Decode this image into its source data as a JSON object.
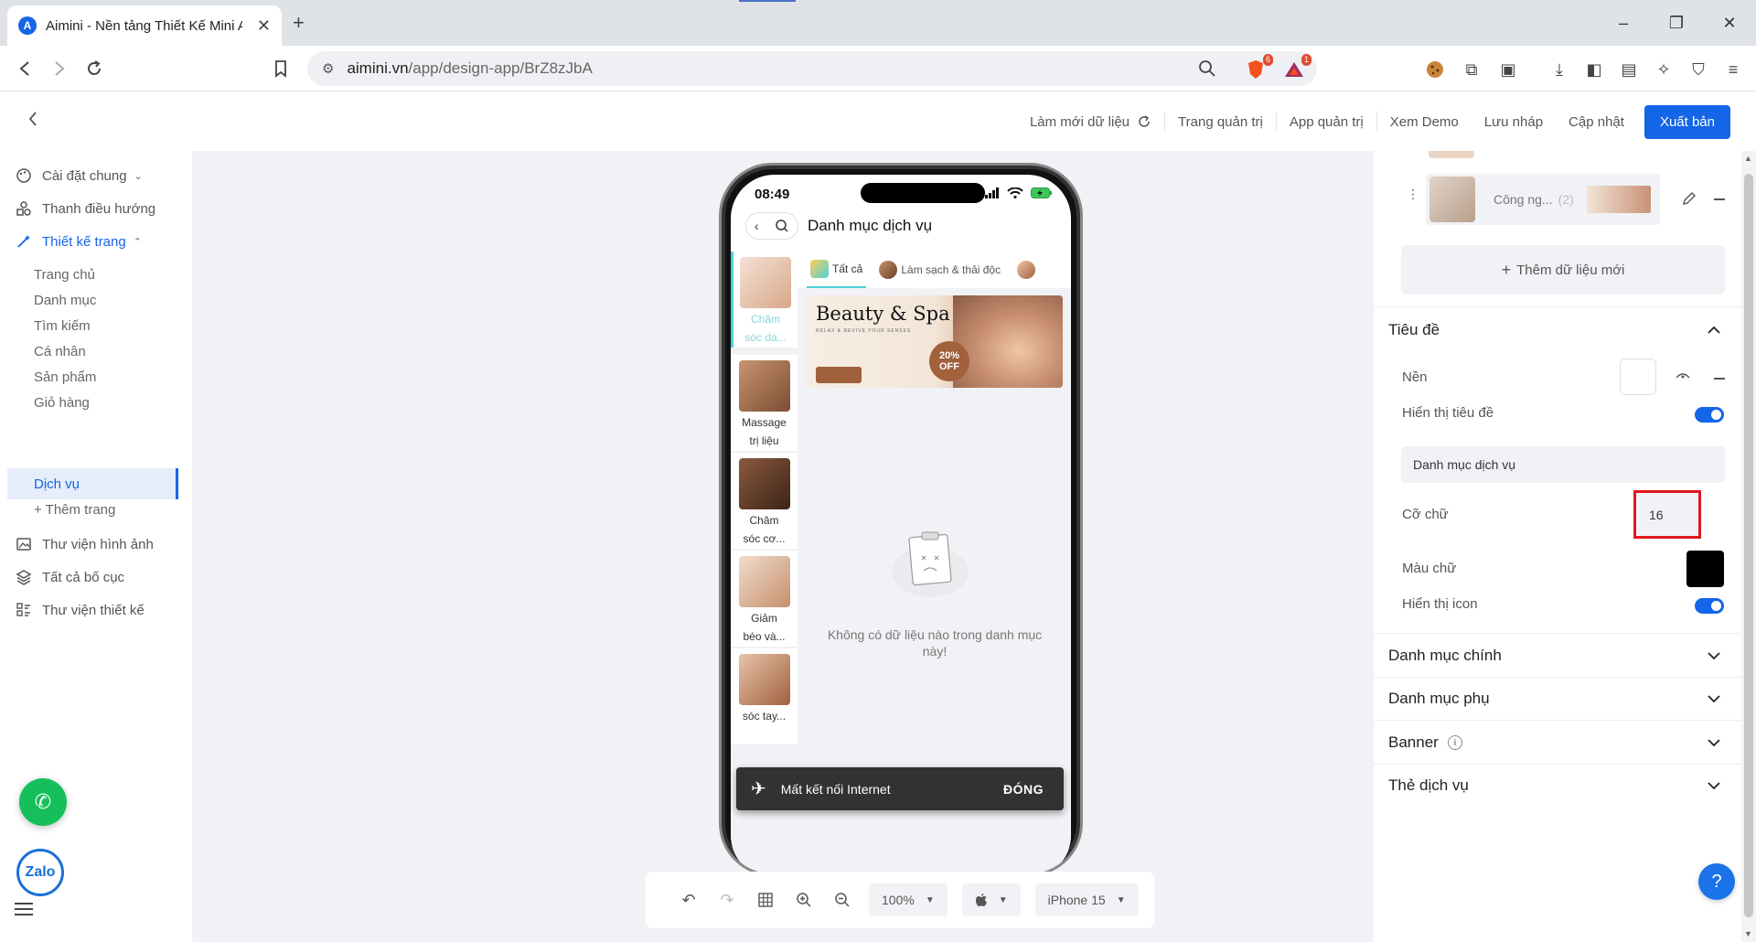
{
  "browser": {
    "tab_title": "Aimini - Nền tảng Thiết Kế Mini App",
    "favicon_letter": "A",
    "new_tab_icon": "plus-icon",
    "url_host": "aimini.vn",
    "url_path": "/app/design-app/BrZ8zJbA",
    "brave_badge": "6",
    "rewards_badge": "1"
  },
  "header": {
    "refresh_label": "Làm mới dữ liệu",
    "admin_page_label": "Trang quản trị",
    "admin_app_label": "App quản trị",
    "demo_label": "Xem Demo",
    "draft_label": "Lưu nháp",
    "update_label": "Cập nhật",
    "publish_label": "Xuất bản"
  },
  "sidebar": {
    "general_settings": "Cài đặt chung",
    "navigation_bar": "Thanh điều hướng",
    "page_design": "Thiết kế trang",
    "pages": [
      "Trang chủ",
      "Danh mục",
      "Tìm kiếm",
      "Cá nhân",
      "Sản phẩm",
      "Giỏ hàng",
      "Dịch vụ"
    ],
    "add_page": "+ Thêm trang",
    "image_library": "Thư viện hình ảnh",
    "all_layouts": "Tất cả bố cục",
    "design_library": "Thư viện thiết kế",
    "zalo_label": "Zalo"
  },
  "phone": {
    "time": "08:49",
    "title": "Danh mục dịch vụ",
    "left_categories": [
      {
        "line1": "Chăm",
        "line2": "sóc da..."
      },
      {
        "line1": "Massage",
        "line2": "trị liệu"
      },
      {
        "line1": "Chăm",
        "line2": "sóc cơ..."
      },
      {
        "line1": "Giảm",
        "line2": "béo và..."
      },
      {
        "line1": "",
        "line2": "sóc tay..."
      }
    ],
    "tabs": [
      "Tất cả",
      "Làm sạch & thải độc"
    ],
    "banner_title": "Beauty & Spa",
    "banner_subtitle": "RELAX & REVIVE YOUR SENSES",
    "banner_discount": "20% OFF",
    "empty_text": "Không có dữ liệu nào trong danh mục này!"
  },
  "snackbar": {
    "message": "Mất kết nối Internet",
    "action": "ĐÓNG"
  },
  "bottombar": {
    "zoom": "100%",
    "device": "iPhone 15"
  },
  "panel": {
    "data_item_name": "Công ng...",
    "data_item_count": "(2)",
    "add_data": "Thêm dữ liệu mới",
    "title_section": "Tiêu đề",
    "bg_label": "Nền",
    "show_title_label": "Hiển thị tiêu đề",
    "show_title": true,
    "title_value": "Danh mục dịch vụ",
    "font_size_label": "Cỡ chữ",
    "font_size_value": "16",
    "text_color_label": "Màu chữ",
    "text_color": "#000000",
    "show_icon_label": "Hiển thị icon",
    "show_icon": true,
    "sections": [
      "Danh mục chính",
      "Danh mục phụ",
      "Banner",
      "Thẻ dịch vụ"
    ],
    "help_label": "?"
  },
  "colors": {
    "primary": "#1565e8",
    "accent_teal": "#4fd0d6",
    "highlight_red": "#e0171e",
    "call_green": "#15c05b"
  }
}
